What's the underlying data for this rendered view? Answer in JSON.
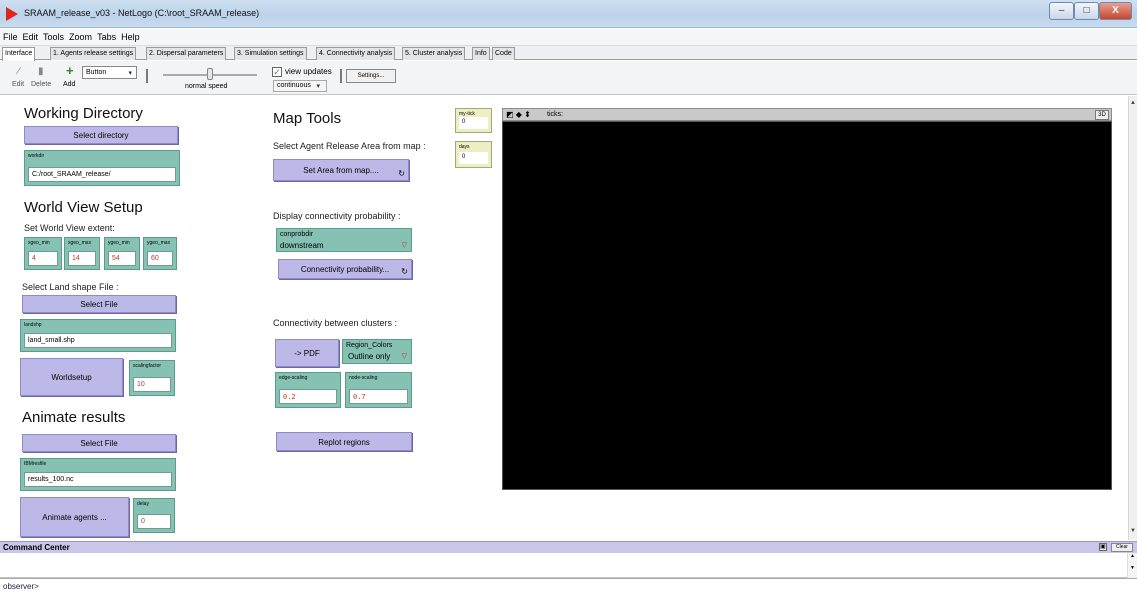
{
  "window": {
    "title": "SRAAM_release_v03 - NetLogo (C:\\root_SRAAM_release)",
    "controls": [
      "–",
      "□",
      "X"
    ]
  },
  "menu": [
    "File",
    "Edit",
    "Tools",
    "Zoom",
    "Tabs",
    "Help"
  ],
  "tabs": [
    "Interface",
    "1. Agents release settings",
    "2. Dispersal parameters",
    "3. Simulation settings",
    "4. Connectivity analysis",
    "5. Cluster analysis",
    "Info",
    "Code"
  ],
  "toolbar": {
    "edit_label": "Edit",
    "delete_label": "Delete",
    "add_label": "Add",
    "widget_type": "Button",
    "speed_label": "normal speed",
    "speed_level": 0.5,
    "view_updates_label": "view updates",
    "view_updates_checked": true,
    "update_mode": "continuous",
    "settings_label": "Settings..."
  },
  "left_panel": {
    "working_directory_heading": "Working Directory",
    "select_directory_button": "Select directory",
    "workdir_label": "workdir",
    "workdir_value": "C:/root_SRAAM_release/",
    "world_view_heading": "World View Setup",
    "world_extent_note": "Set World View extent:",
    "xgeo_min_label": "xgeo_min",
    "xgeo_min_value": "4",
    "xgeo_max_label": "xgeo_max",
    "xgeo_max_value": "14",
    "ygeo_min_label": "ygeo_min",
    "ygeo_min_value": "54",
    "ygeo_max_label": "ygeo_max",
    "ygeo_max_value": "60",
    "land_shape_note": "Select Land shape File :",
    "select_file_button": "Select File",
    "landshp_label": "landshp",
    "landshp_value": "land_small.shp",
    "worldsetup_button": "Worldsetup",
    "scalingfactor_label": "scalingfactor",
    "scalingfactor_value": "10",
    "animate_heading": "Animate results",
    "select_file_button_2": "Select File",
    "ibmresfile_label": "IBMresfile",
    "ibmresfile_value": "results_100.nc",
    "animate_button": "Animate agents ...",
    "delay_label": "delay",
    "delay_value": "0"
  },
  "map_tools": {
    "heading": "Map Tools",
    "release_area_note": "Select Agent Release Area from map :",
    "set_area_button": "Set Area from map....",
    "connectivity_note": "Display connectivity probability :",
    "conprobdir_label": "conprobdir",
    "conprobdir_value": "downstream",
    "connectivity_button": "Connectivity probability...",
    "clusters_note": "Connectivity between clusters :",
    "pdf_button": "-> PDF",
    "region_colors_label": "Region_Colors",
    "region_colors_value": "Outline only",
    "edge_scaling_label": "edge-scaling",
    "edge_scaling_value": "0.2",
    "node_scaling_label": "node-scaling",
    "node_scaling_value": "0.7",
    "replot_button": "Replot regions"
  },
  "monitors": {
    "my_tick_label": "my-tick",
    "my_tick_value": "0",
    "days_label": "days",
    "days_value": "0"
  },
  "view": {
    "ticks_label": "ticks:",
    "three_d_label": "3D",
    "background": "#000000"
  },
  "command_center": {
    "title": "Command Center",
    "clear_label": "Clear",
    "prompt": "observer>",
    "input_value": ""
  },
  "colors": {
    "button": "#bcb9e8",
    "input": "#86c2b4",
    "monitor": "#eeeec4",
    "numeric_text": "#b73a26"
  }
}
